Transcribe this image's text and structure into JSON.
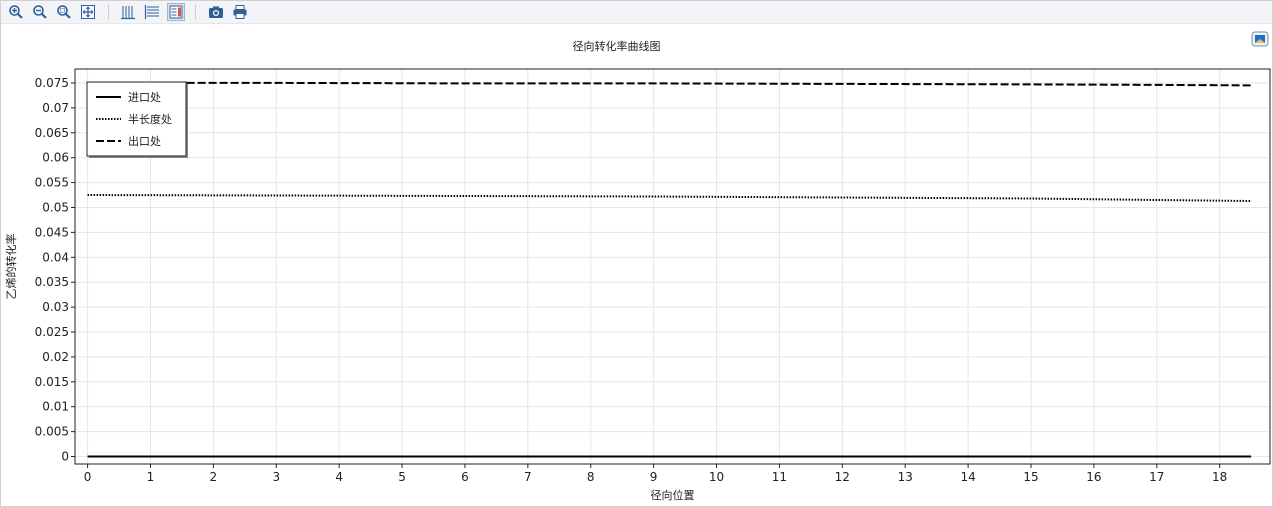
{
  "toolbar": {
    "buttons": [
      {
        "name": "zoom-in-icon"
      },
      {
        "name": "zoom-out-icon"
      },
      {
        "name": "zoom-box-icon"
      },
      {
        "name": "zoom-extents-icon"
      },
      {
        "name": "x-grid-icon"
      },
      {
        "name": "y-grid-icon"
      },
      {
        "name": "legend-toggle-icon",
        "active": true
      },
      {
        "name": "camera-icon"
      },
      {
        "name": "print-icon"
      }
    ],
    "accent": "#2d6db5"
  },
  "chart_data": {
    "type": "line",
    "title": "径向转化率曲线图",
    "xlabel": "径向位置",
    "ylabel": "乙烯的转化率",
    "xlim": [
      -0.2,
      18.8
    ],
    "ylim": [
      -0.0015,
      0.0778
    ],
    "x_ticks": [
      "0",
      "1",
      "2",
      "3",
      "4",
      "5",
      "6",
      "7",
      "8",
      "9",
      "10",
      "11",
      "12",
      "13",
      "14",
      "15",
      "16",
      "17",
      "18"
    ],
    "y_ticks": [
      "0",
      "0.005",
      "0.01",
      "0.015",
      "0.02",
      "0.025",
      "0.03",
      "0.035",
      "0.04",
      "0.045",
      "0.05",
      "0.055",
      "0.06",
      "0.065",
      "0.07",
      "0.075"
    ],
    "grid": true,
    "legend_position": "top-left",
    "series": [
      {
        "name": "进口处",
        "style": "solid",
        "color": "#000000",
        "points": [
          [
            0,
            0
          ],
          [
            18.5,
            0
          ]
        ]
      },
      {
        "name": "半长度处",
        "style": "dotted",
        "color": "#000000",
        "points": [
          [
            0,
            0.0525
          ],
          [
            3,
            0.0524
          ],
          [
            6,
            0.0523
          ],
          [
            9,
            0.0522
          ],
          [
            12,
            0.052
          ],
          [
            15,
            0.0518
          ],
          [
            17,
            0.0515
          ],
          [
            18.5,
            0.0513
          ]
        ]
      },
      {
        "name": "出口处",
        "style": "dashed",
        "color": "#000000",
        "points": [
          [
            0,
            0.075
          ],
          [
            3,
            0.075
          ],
          [
            6,
            0.0749
          ],
          [
            9,
            0.0749
          ],
          [
            12,
            0.0748
          ],
          [
            15,
            0.0747
          ],
          [
            17,
            0.0746
          ],
          [
            18.5,
            0.0745
          ]
        ]
      }
    ]
  }
}
